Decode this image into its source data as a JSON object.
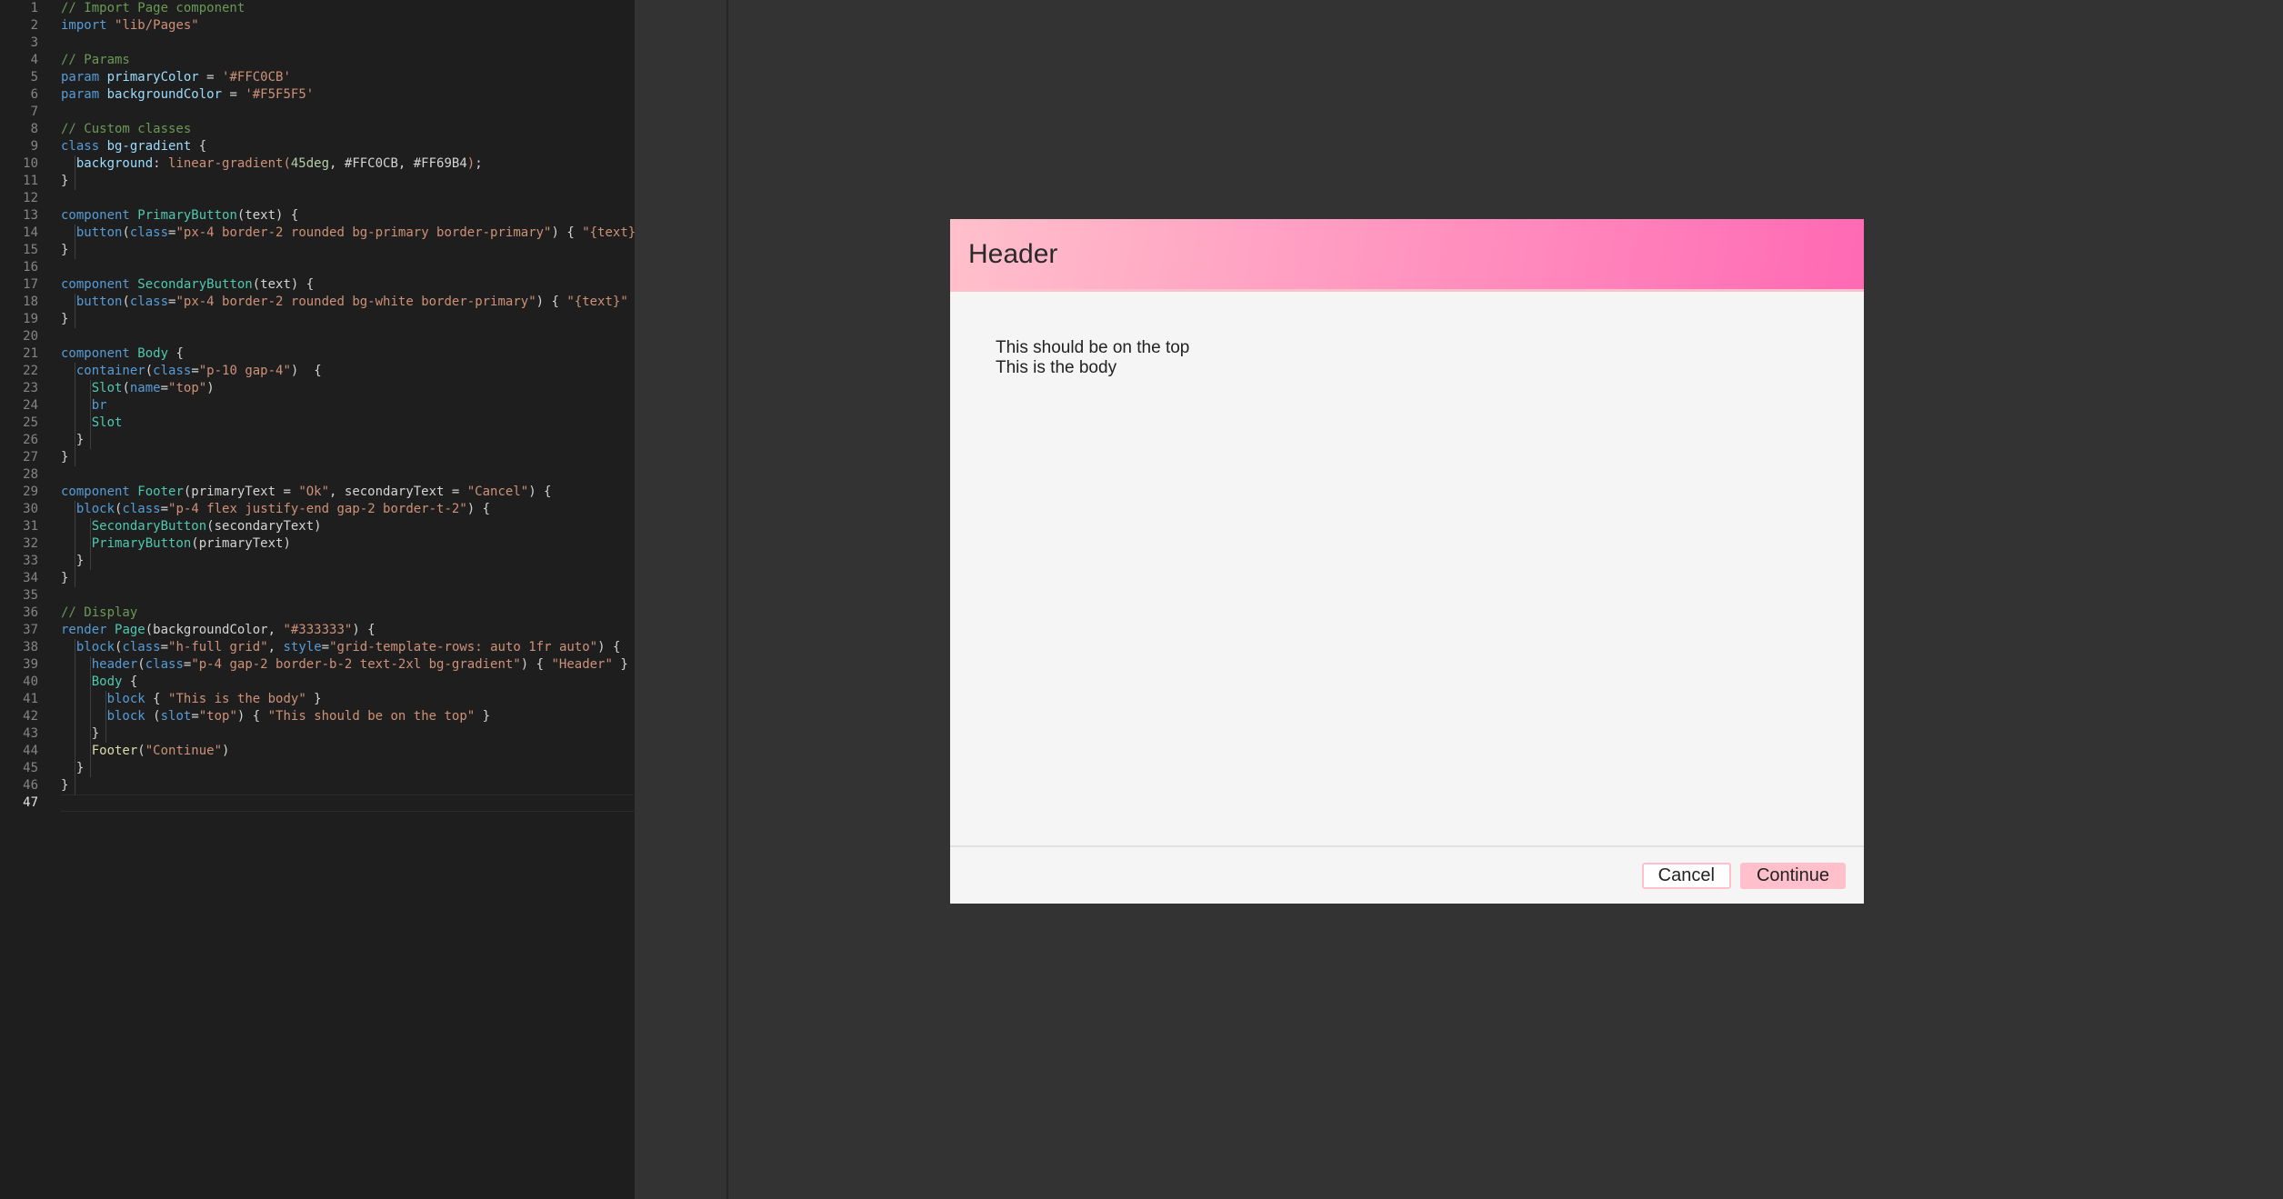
{
  "editor": {
    "active_line": 47,
    "lines": [
      [
        [
          "t-com",
          "// Import Page component"
        ]
      ],
      [
        [
          "t-kw",
          "import "
        ],
        [
          "t-str",
          "\"lib/Pages\""
        ]
      ],
      [],
      [
        [
          "t-com",
          "// Params"
        ]
      ],
      [
        [
          "t-kw",
          "param "
        ],
        [
          "t-prop",
          "primaryColor"
        ],
        [
          "t-txt",
          " = "
        ],
        [
          "t-str",
          "'#FFC0CB'"
        ]
      ],
      [
        [
          "t-kw",
          "param "
        ],
        [
          "t-prop",
          "backgroundColor"
        ],
        [
          "t-txt",
          " = "
        ],
        [
          "t-str",
          "'#F5F5F5'"
        ]
      ],
      [],
      [
        [
          "t-com",
          "// Custom classes"
        ]
      ],
      [
        [
          "t-kw",
          "class "
        ],
        [
          "t-prop",
          "bg-gradient"
        ],
        [
          "t-txt",
          " {"
        ]
      ],
      [
        [
          "t-txt",
          "  "
        ],
        [
          "t-prop",
          "background"
        ],
        [
          "t-txt",
          ": "
        ],
        [
          "t-str",
          "linear-gradient("
        ],
        [
          "t-num",
          "45deg"
        ],
        [
          "t-txt",
          ", #FFC0CB, #FF69B4"
        ],
        [
          "t-str",
          ")"
        ],
        [
          "t-txt",
          ";"
        ]
      ],
      [
        [
          "t-txt",
          "}"
        ]
      ],
      [],
      [
        [
          "t-kw",
          "component "
        ],
        [
          "t-cls",
          "PrimaryButton"
        ],
        [
          "t-txt",
          "(text) {"
        ]
      ],
      [
        [
          "t-txt",
          "  "
        ],
        [
          "t-kw",
          "button"
        ],
        [
          "t-txt",
          "("
        ],
        [
          "t-kw",
          "class"
        ],
        [
          "t-txt",
          "="
        ],
        [
          "t-str",
          "\"px-4 border-2 rounded bg-primary border-primary\""
        ],
        [
          "t-txt",
          ") { "
        ],
        [
          "t-str",
          "\"{text}\""
        ],
        [
          "t-txt",
          " }"
        ]
      ],
      [
        [
          "t-txt",
          "}"
        ]
      ],
      [],
      [
        [
          "t-kw",
          "component "
        ],
        [
          "t-cls",
          "SecondaryButton"
        ],
        [
          "t-txt",
          "(text) {"
        ]
      ],
      [
        [
          "t-txt",
          "  "
        ],
        [
          "t-kw",
          "button"
        ],
        [
          "t-txt",
          "("
        ],
        [
          "t-kw",
          "class"
        ],
        [
          "t-txt",
          "="
        ],
        [
          "t-str",
          "\"px-4 border-2 rounded bg-white border-primary\""
        ],
        [
          "t-txt",
          ") { "
        ],
        [
          "t-str",
          "\"{text}\""
        ],
        [
          "t-txt",
          " }"
        ]
      ],
      [
        [
          "t-txt",
          "}"
        ]
      ],
      [],
      [
        [
          "t-kw",
          "component "
        ],
        [
          "t-cls",
          "Body"
        ],
        [
          "t-txt",
          " {"
        ]
      ],
      [
        [
          "t-txt",
          "  "
        ],
        [
          "t-kw",
          "container"
        ],
        [
          "t-txt",
          "("
        ],
        [
          "t-kw",
          "class"
        ],
        [
          "t-txt",
          "="
        ],
        [
          "t-str",
          "\"p-10 gap-4\""
        ],
        [
          "t-txt",
          ")  {"
        ]
      ],
      [
        [
          "t-txt",
          "    "
        ],
        [
          "t-cls",
          "Slot"
        ],
        [
          "t-txt",
          "("
        ],
        [
          "t-kw",
          "name"
        ],
        [
          "t-txt",
          "="
        ],
        [
          "t-str",
          "\"top\""
        ],
        [
          "t-txt",
          ")"
        ]
      ],
      [
        [
          "t-txt",
          "    "
        ],
        [
          "t-kw",
          "br"
        ]
      ],
      [
        [
          "t-txt",
          "    "
        ],
        [
          "t-cls",
          "Slot"
        ]
      ],
      [
        [
          "t-txt",
          "  }"
        ]
      ],
      [
        [
          "t-txt",
          "}"
        ]
      ],
      [],
      [
        [
          "t-kw",
          "component "
        ],
        [
          "t-cls",
          "Footer"
        ],
        [
          "t-txt",
          "(primaryText = "
        ],
        [
          "t-str",
          "\"Ok\""
        ],
        [
          "t-txt",
          ", secondaryText = "
        ],
        [
          "t-str",
          "\"Cancel\""
        ],
        [
          "t-txt",
          ") {"
        ]
      ],
      [
        [
          "t-txt",
          "  "
        ],
        [
          "t-kw",
          "block"
        ],
        [
          "t-txt",
          "("
        ],
        [
          "t-kw",
          "class"
        ],
        [
          "t-txt",
          "="
        ],
        [
          "t-str",
          "\"p-4 flex justify-end gap-2 border-t-2\""
        ],
        [
          "t-txt",
          ") {"
        ]
      ],
      [
        [
          "t-txt",
          "    "
        ],
        [
          "t-cls",
          "SecondaryButton"
        ],
        [
          "t-txt",
          "(secondaryText)"
        ]
      ],
      [
        [
          "t-txt",
          "    "
        ],
        [
          "t-cls",
          "PrimaryButton"
        ],
        [
          "t-txt",
          "(primaryText)"
        ]
      ],
      [
        [
          "t-txt",
          "  }"
        ]
      ],
      [
        [
          "t-txt",
          "}"
        ]
      ],
      [],
      [
        [
          "t-com",
          "// Display"
        ]
      ],
      [
        [
          "t-kw",
          "render "
        ],
        [
          "t-cls",
          "Page"
        ],
        [
          "t-txt",
          "(backgroundColor, "
        ],
        [
          "t-str",
          "\"#333333\""
        ],
        [
          "t-txt",
          ") {"
        ]
      ],
      [
        [
          "t-txt",
          "  "
        ],
        [
          "t-kw",
          "block"
        ],
        [
          "t-txt",
          "("
        ],
        [
          "t-kw",
          "class"
        ],
        [
          "t-txt",
          "="
        ],
        [
          "t-str",
          "\"h-full grid\""
        ],
        [
          "t-txt",
          ", "
        ],
        [
          "t-kw",
          "style"
        ],
        [
          "t-txt",
          "="
        ],
        [
          "t-str",
          "\"grid-template-rows: auto 1fr auto\""
        ],
        [
          "t-txt",
          ") {"
        ]
      ],
      [
        [
          "t-txt",
          "    "
        ],
        [
          "t-kw",
          "header"
        ],
        [
          "t-txt",
          "("
        ],
        [
          "t-kw",
          "class"
        ],
        [
          "t-txt",
          "="
        ],
        [
          "t-str",
          "\"p-4 gap-2 border-b-2 text-2xl bg-gradient\""
        ],
        [
          "t-txt",
          ") { "
        ],
        [
          "t-str",
          "\"Header\""
        ],
        [
          "t-txt",
          " }"
        ]
      ],
      [
        [
          "t-txt",
          "    "
        ],
        [
          "t-cls",
          "Body"
        ],
        [
          "t-txt",
          " {"
        ]
      ],
      [
        [
          "t-txt",
          "      "
        ],
        [
          "t-kw",
          "block"
        ],
        [
          "t-txt",
          " { "
        ],
        [
          "t-str",
          "\"This is the body\""
        ],
        [
          "t-txt",
          " }"
        ]
      ],
      [
        [
          "t-txt",
          "      "
        ],
        [
          "t-kw",
          "block"
        ],
        [
          "t-txt",
          " ("
        ],
        [
          "t-kw",
          "slot"
        ],
        [
          "t-txt",
          "="
        ],
        [
          "t-str",
          "\"top\""
        ],
        [
          "t-txt",
          ") { "
        ],
        [
          "t-str",
          "\"This should be on the top\""
        ],
        [
          "t-txt",
          " }"
        ]
      ],
      [
        [
          "t-txt",
          "    }"
        ]
      ],
      [
        [
          "t-txt",
          "    "
        ],
        [
          "t-fn",
          "Footer"
        ],
        [
          "t-txt",
          "("
        ],
        [
          "t-str",
          "\"Continue\""
        ],
        [
          "t-txt",
          ")"
        ]
      ],
      [
        [
          "t-txt",
          "  }"
        ]
      ],
      [
        [
          "t-txt",
          "}"
        ]
      ],
      []
    ]
  },
  "preview": {
    "header": "Header",
    "body_top": "This should be on the top",
    "body_main": "This is the body",
    "cancel_label": "Cancel",
    "continue_label": "Continue"
  },
  "colors": {
    "primary": "#FFC0CB",
    "background": "#F5F5F5",
    "page_background": "#333333",
    "gradient_end": "#FF69B4"
  }
}
